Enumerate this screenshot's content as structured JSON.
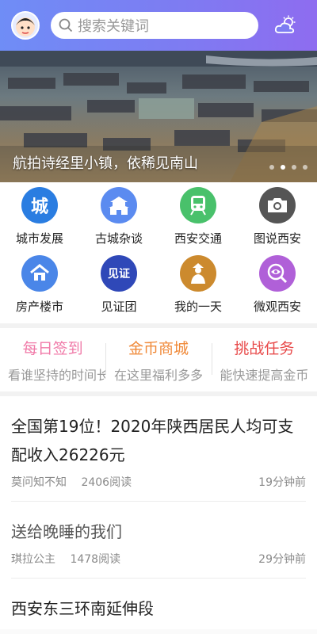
{
  "header": {
    "search_placeholder": "搜索关键词",
    "avatar_icon": "avatar-icon",
    "weather_icon": "cloud-sun-icon",
    "gradient_start": "#6f8df6",
    "gradient_end": "#8e6cf0"
  },
  "banner": {
    "caption": "航拍诗经里小镇，依稀见南山",
    "dots_total": 4,
    "dot_active_index": 1
  },
  "grid": {
    "items": [
      {
        "label": "城市发展",
        "icon": "cheng-badge-icon",
        "glyph": "城",
        "color": "#2a7de1"
      },
      {
        "label": "古城杂谈",
        "icon": "city-gate-icon",
        "glyph": "",
        "color": "#5b8bf0"
      },
      {
        "label": "西安交通",
        "icon": "train-icon",
        "glyph": "",
        "color": "#49c16b"
      },
      {
        "label": "图说西安",
        "icon": "camera-icon",
        "glyph": "",
        "color": "#555555"
      },
      {
        "label": "房产楼市",
        "icon": "house-icon",
        "glyph": "",
        "color": "#4a86e8"
      },
      {
        "label": "见证团",
        "icon": "witness-badge-icon",
        "glyph": "见证",
        "color": "#2f48b8"
      },
      {
        "label": "我的一天",
        "icon": "person-icon",
        "glyph": "",
        "color": "#cc8a2e"
      },
      {
        "label": "微观西安",
        "icon": "eye-magnifier-icon",
        "glyph": "",
        "color": "#b060d8"
      }
    ]
  },
  "tasks": [
    {
      "title": "每日签到",
      "sub": "看谁坚持的时间长",
      "color": "#f07aa8"
    },
    {
      "title": "金币商城",
      "sub": "在这里福利多多",
      "color": "#f08a3a"
    },
    {
      "title": "挑战任务",
      "sub": "能快速提高金币",
      "color": "#e84a4a"
    }
  ],
  "articles": [
    {
      "title": "全国第19位！2020年陕西居民人均可支配收入26226元",
      "author": "莫问知不知",
      "reads": "2406阅读",
      "time": "19分钟前"
    },
    {
      "title": "送给晚睡的我们",
      "author": "琪拉公主",
      "reads": "1478阅读",
      "time": "29分钟前"
    },
    {
      "title": "西安东三环南延伸段",
      "author": "",
      "reads": "",
      "time": ""
    }
  ]
}
